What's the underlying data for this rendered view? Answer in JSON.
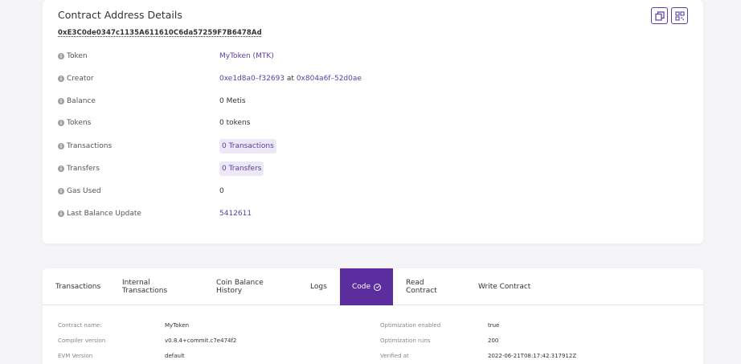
{
  "details": {
    "title": "Contract Address Details",
    "address": "0xE3C0de0347c1135A611610C6da57259F7B6478Ad",
    "buttons": {
      "copy_icon": "copy-icon",
      "qr_icon": "qr-code-icon"
    },
    "rows": [
      {
        "label": "Token",
        "value": "MyToken (MTK)"
      },
      {
        "label": "Creator",
        "value_parts": [
          "0xe1d8a0–f32693",
          "at",
          "0x804a6f–52d0ae"
        ]
      },
      {
        "label": "Balance",
        "value": "0 Metis"
      },
      {
        "label": "Tokens",
        "value": "0 tokens"
      },
      {
        "label": "Transactions",
        "value": "0 Transactions"
      },
      {
        "label": "Transfers",
        "value": "0 Transfers"
      },
      {
        "label": "Gas Used",
        "value": "0"
      },
      {
        "label": "Last Balance Update",
        "value": "5412611"
      }
    ]
  },
  "tabs": [
    {
      "label": "Transactions"
    },
    {
      "label": "Internal Transactions"
    },
    {
      "label": "Coin Balance History"
    },
    {
      "label": "Logs"
    },
    {
      "label": "Code"
    },
    {
      "label": "Read Contract"
    },
    {
      "label": "Write Contract"
    }
  ],
  "active_tab": "Code",
  "contract_info": {
    "left": [
      {
        "label": "Contract name:",
        "value": "MyToken"
      },
      {
        "label": "Compiler version",
        "value": "v0.8.4+commit.c7e474f2"
      },
      {
        "label": "EVM Version",
        "value": "default"
      }
    ],
    "right": [
      {
        "label": "Optimization enabled",
        "value": "true"
      },
      {
        "label": "Optimization runs",
        "value": "200"
      },
      {
        "label": "Verified at",
        "value": "2022-06-21T08:17:42.317912Z"
      }
    ]
  },
  "colors": {
    "accent": "#5b2d9e",
    "link": "#5b3ea8",
    "pill_bg": "#ece8f5"
  }
}
